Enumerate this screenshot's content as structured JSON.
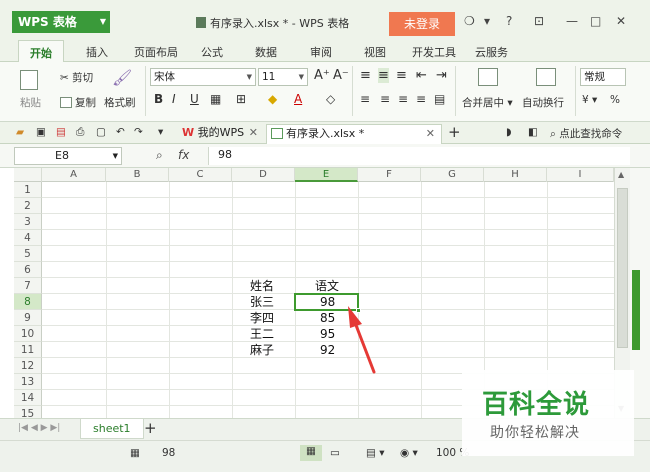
{
  "app": {
    "name": "WPS 表格",
    "doc_title": "有序录入.xlsx * - WPS 表格",
    "login": "未登录"
  },
  "window_controls": [
    "?",
    "—",
    "□",
    "✕"
  ],
  "menu_tabs": [
    "开始",
    "插入",
    "页面布局",
    "公式",
    "数据",
    "审阅",
    "视图",
    "开发工具",
    "云服务"
  ],
  "ribbon": {
    "paste": "粘贴",
    "cut": "剪切",
    "copy": "复制",
    "format_painter": "格式刷",
    "font_name": "宋体",
    "font_size": "11",
    "merge_center": "合并居中",
    "wrap_text": "自动换行",
    "number_format": "常规",
    "percent": "%"
  },
  "doc_tabs": {
    "tab1": "我的WPS",
    "tab2": "有序录入.xlsx *",
    "search": "点此查找命令"
  },
  "formula_bar": {
    "cell_ref": "E8",
    "fx": "fx",
    "value": "98"
  },
  "columns": [
    "A",
    "B",
    "C",
    "D",
    "E",
    "F",
    "G",
    "H",
    "I"
  ],
  "rows": [
    "1",
    "2",
    "3",
    "4",
    "5",
    "6",
    "7",
    "8",
    "9",
    "10",
    "11",
    "12",
    "13",
    "14",
    "15"
  ],
  "cells": {
    "D7": "姓名",
    "E7": "语文",
    "D8": "张三",
    "E8": "98",
    "D9": "李四",
    "E9": "85",
    "D10": "王二",
    "E10": "95",
    "D11": "麻子",
    "E11": "92"
  },
  "sheets": [
    "sheet1"
  ],
  "status": {
    "value": "98",
    "zoom": "100 %"
  },
  "watermark": {
    "title": "百科全说",
    "subtitle": "助你轻松解决"
  },
  "colors": {
    "accent": "#3e9a2e",
    "login": "#f07850",
    "arrow": "#e53935"
  }
}
